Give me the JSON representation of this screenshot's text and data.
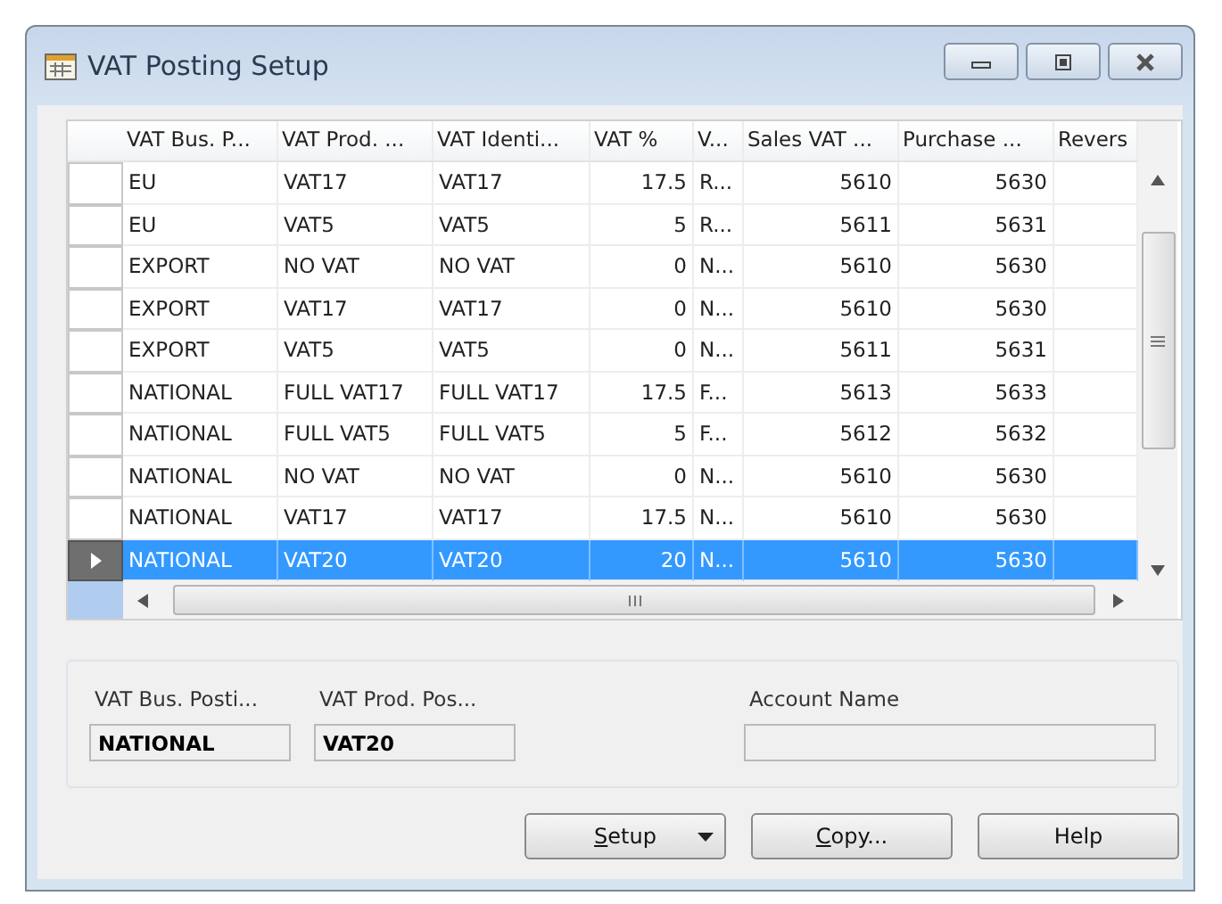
{
  "window": {
    "title": "VAT Posting Setup"
  },
  "table": {
    "columns": [
      "VAT Bus. P...",
      "VAT Prod. ...",
      "VAT Identi...",
      "VAT %",
      "V...",
      "Sales VAT ...",
      "Purchase ...",
      "Revers"
    ],
    "rows": [
      {
        "cells": [
          "EU",
          "VAT17",
          "VAT17",
          "17.5",
          "R...",
          "5610",
          "5630"
        ],
        "selected": false
      },
      {
        "cells": [
          "EU",
          "VAT5",
          "VAT5",
          "5",
          "R...",
          "5611",
          "5631"
        ],
        "selected": false
      },
      {
        "cells": [
          "EXPORT",
          "NO VAT",
          "NO VAT",
          "0",
          "N...",
          "5610",
          "5630"
        ],
        "selected": false
      },
      {
        "cells": [
          "EXPORT",
          "VAT17",
          "VAT17",
          "0",
          "N...",
          "5610",
          "5630"
        ],
        "selected": false
      },
      {
        "cells": [
          "EXPORT",
          "VAT5",
          "VAT5",
          "0",
          "N...",
          "5611",
          "5631"
        ],
        "selected": false
      },
      {
        "cells": [
          "NATIONAL",
          "FULL VAT17",
          "FULL VAT17",
          "17.5",
          "F...",
          "5613",
          "5633"
        ],
        "selected": false
      },
      {
        "cells": [
          "NATIONAL",
          "FULL VAT5",
          "FULL VAT5",
          "5",
          "F...",
          "5612",
          "5632"
        ],
        "selected": false
      },
      {
        "cells": [
          "NATIONAL",
          "NO VAT",
          "NO VAT",
          "0",
          "N...",
          "5610",
          "5630"
        ],
        "selected": false
      },
      {
        "cells": [
          "NATIONAL",
          "VAT17",
          "VAT17",
          "17.5",
          "N...",
          "5610",
          "5630"
        ],
        "selected": false
      },
      {
        "cells": [
          "NATIONAL",
          "VAT20",
          "VAT20",
          "20",
          "N...",
          "5610",
          "5630"
        ],
        "selected": true
      }
    ]
  },
  "details": [
    {
      "label": "VAT Bus. Posti...",
      "value": "NATIONAL"
    },
    {
      "label": "VAT Prod. Pos...",
      "value": "VAT20"
    },
    {
      "label": "Account Name"
    }
  ],
  "buttons": [
    {
      "label": "Setup",
      "kind": "dropdown"
    },
    {
      "label": "Copy...",
      "kind": "plain"
    },
    {
      "label": "Help",
      "kind": "plain"
    }
  ]
}
